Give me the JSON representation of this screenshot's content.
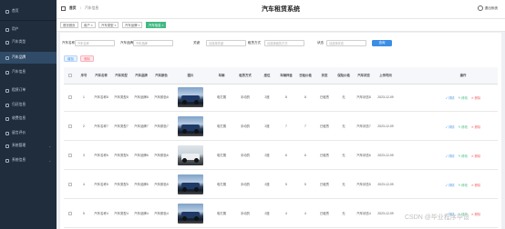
{
  "sidebar": {
    "items": [
      {
        "label": "首页",
        "icon": "home-icon",
        "active": false,
        "arrow": false
      },
      {
        "label": "用户",
        "icon": "user-icon",
        "active": false,
        "arrow": false
      },
      {
        "label": "汽车类型",
        "icon": "list-icon",
        "active": false,
        "arrow": false
      },
      {
        "label": "汽车品牌",
        "icon": "tag-icon",
        "active": true,
        "arrow": false
      },
      {
        "label": "汽车信息",
        "icon": "car-icon",
        "active": false,
        "arrow": false
      },
      {
        "label": "租赁订单",
        "icon": "order-icon",
        "active": false,
        "arrow": false
      },
      {
        "label": "归还信息",
        "icon": "return-icon",
        "active": false,
        "arrow": false
      },
      {
        "label": "收费信息",
        "icon": "money-icon",
        "active": false,
        "arrow": false
      },
      {
        "label": "留言评价",
        "icon": "comment-icon",
        "active": false,
        "arrow": false
      },
      {
        "label": "系统管理",
        "icon": "gear-icon",
        "active": false,
        "arrow": true
      },
      {
        "label": "系统信息",
        "icon": "info-icon",
        "active": false,
        "arrow": true
      }
    ]
  },
  "header": {
    "breadcrumb_home": "首页",
    "breadcrumb_sep": "/",
    "breadcrumb_current": "汽车信息",
    "title": "汽车租赁系统",
    "logout": "退出系统"
  },
  "tags": [
    "首页首页",
    "用户 ×",
    "汽车类型 ×",
    "汽车品牌 ×",
    "汽车信息 ×"
  ],
  "filters": {
    "name_label": "汽车名称",
    "name_placeholder": "汽车名称",
    "brand_label": "汽车品牌",
    "brand_placeholder": "汽车品牌",
    "type_label": "关键",
    "type_placeholder": "请选择关键",
    "lease_label": "租赁方式",
    "lease_placeholder": "请选择租赁方式",
    "status_label": "状态",
    "status_placeholder": "请选择状态",
    "search_button": "查询"
  },
  "actions": {
    "add": "增加",
    "delete": "删除"
  },
  "table": {
    "headers": [
      "",
      "序号",
      "汽车名称",
      "汽车类型",
      "汽车品牌",
      "汽车颜色",
      "图片",
      "车辆",
      "租赁方式",
      "座位",
      "车辆押金",
      "日租价格",
      "状态",
      "保险价格",
      "汽车状态",
      "上传时间",
      "操作"
    ],
    "rows": [
      {
        "no": "1",
        "name": "汽车名称8",
        "type": "汽车类型8",
        "brand": "汽车品牌8",
        "color": "汽车颜色8",
        "img": "blue",
        "car": "电打展",
        "lease": "手动的",
        "seat": "2座",
        "deposit": "8",
        "daily": "8",
        "status": "已租赁",
        "insure": "无",
        "carstatus": "汽车状态8",
        "time": "2023-12-09"
      },
      {
        "no": "2",
        "name": "汽车名称7",
        "type": "汽车类型7",
        "brand": "汽车品牌7",
        "color": "汽车颜色7",
        "img": "blue",
        "car": "电打展",
        "lease": "手动的",
        "seat": "2座",
        "deposit": "7",
        "daily": "7",
        "status": "已租赁",
        "insure": "无",
        "carstatus": "汽车状态7",
        "time": "2023-12-09"
      },
      {
        "no": "3",
        "name": "汽车名称6",
        "type": "汽车类型6",
        "brand": "汽车品牌6",
        "color": "汽车颜色6",
        "img": "white",
        "car": "电打展",
        "lease": "手动的",
        "seat": "2座",
        "deposit": "6",
        "daily": "6",
        "status": "已租赁",
        "insure": "无",
        "carstatus": "汽车状态6",
        "time": "2023-12-09"
      },
      {
        "no": "4",
        "name": "汽车名称5",
        "type": "汽车类型5",
        "brand": "汽车品牌5",
        "color": "汽车颜色5",
        "img": "blue",
        "car": "电打展",
        "lease": "手动的",
        "seat": "2座",
        "deposit": "5",
        "daily": "5",
        "status": "已租赁",
        "insure": "无",
        "carstatus": "汽车状态5",
        "time": "2023-12-09"
      },
      {
        "no": "5",
        "name": "汽车名称4",
        "type": "汽车类型4",
        "brand": "汽车品牌4",
        "color": "汽车颜色4",
        "img": "blue",
        "car": "电打展",
        "lease": "手动的",
        "seat": "2座",
        "deposit": "4",
        "daily": "4",
        "status": "已租赁",
        "insure": "无",
        "carstatus": "汽车状态4",
        "time": "2023-12-09"
      }
    ],
    "op_view": "详情",
    "op_edit": "修改",
    "op_delete": "删除"
  },
  "watermark": "CSDN @毕业程序毕设",
  "colors": {
    "sidebar_bg": "#1f2d3d",
    "sidebar_active": "#2f4b67",
    "primary": "#3a8ee6",
    "success": "#42b983",
    "danger": "#f56c6c"
  }
}
